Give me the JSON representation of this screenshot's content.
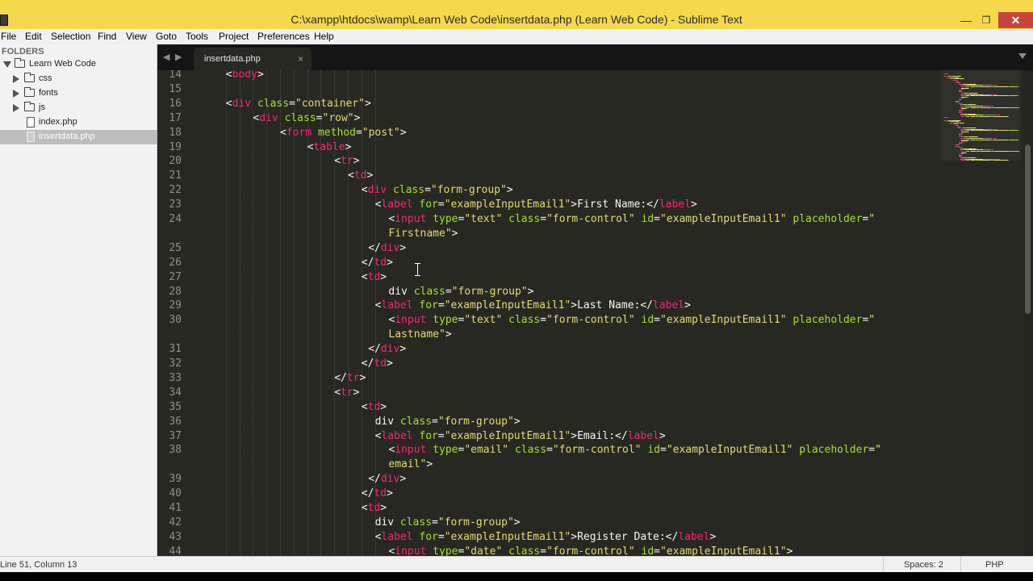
{
  "window": {
    "title": "C:\\xampp\\htdocs\\wamp\\Learn Web Code\\insertdata.php (Learn Web Code) - Sublime Text",
    "minimize": "—",
    "maximize": "❐",
    "close": "✕"
  },
  "menu": [
    "File",
    "Edit",
    "Selection",
    "Find",
    "View",
    "Goto",
    "Tools",
    "Project",
    "Preferences",
    "Help"
  ],
  "sidebar": {
    "header": "FOLDERS",
    "root": "Learn Web Code",
    "items": [
      {
        "label": "css",
        "type": "folder",
        "icon": "folder-icon"
      },
      {
        "label": "fonts",
        "type": "folder",
        "icon": "folder-icon"
      },
      {
        "label": "js",
        "type": "folder",
        "icon": "folder-icon"
      },
      {
        "label": "index.php",
        "type": "file",
        "icon": "file-icon"
      },
      {
        "label": "insertdata.php",
        "type": "file",
        "icon": "file-icon",
        "active": true
      }
    ]
  },
  "tabs": {
    "back": "◀",
    "forward": "▶",
    "active": {
      "label": "insertdata.php",
      "close": "×"
    }
  },
  "editor": {
    "lines": [
      {
        "n": "14",
        "indent": 2,
        "segs": [
          [
            "t",
            "<"
          ],
          [
            "k",
            "body"
          ],
          [
            "t",
            ">"
          ]
        ]
      },
      {
        "n": "15",
        "indent": 0,
        "segs": []
      },
      {
        "n": "16",
        "indent": 2,
        "segs": [
          [
            "t",
            "<"
          ],
          [
            "k",
            "div"
          ],
          [
            "t",
            " "
          ],
          [
            "a",
            "class"
          ],
          [
            "t",
            "="
          ],
          [
            "s",
            "\"container\""
          ],
          [
            "t",
            ">"
          ]
        ]
      },
      {
        "n": "17",
        "indent": 6,
        "segs": [
          [
            "t",
            "<"
          ],
          [
            "k",
            "div"
          ],
          [
            "t",
            " "
          ],
          [
            "a",
            "class"
          ],
          [
            "t",
            "="
          ],
          [
            "s",
            "\"row\""
          ],
          [
            "t",
            ">"
          ]
        ]
      },
      {
        "n": "18",
        "indent": 10,
        "segs": [
          [
            "t",
            "<"
          ],
          [
            "k",
            "form"
          ],
          [
            "t",
            " "
          ],
          [
            "a",
            "method"
          ],
          [
            "t",
            "="
          ],
          [
            "s",
            "\"post\""
          ],
          [
            "t",
            ">"
          ]
        ]
      },
      {
        "n": "19",
        "indent": 14,
        "segs": [
          [
            "t",
            "<"
          ],
          [
            "k",
            "table"
          ],
          [
            "t",
            ">"
          ]
        ]
      },
      {
        "n": "20",
        "indent": 18,
        "segs": [
          [
            "t",
            "<"
          ],
          [
            "k",
            "tr"
          ],
          [
            "t",
            ">"
          ]
        ]
      },
      {
        "n": "21",
        "indent": 20,
        "segs": [
          [
            "t",
            "<"
          ],
          [
            "k",
            "td"
          ],
          [
            "t",
            ">"
          ]
        ]
      },
      {
        "n": "22",
        "indent": 22,
        "segs": [
          [
            "t",
            "<"
          ],
          [
            "k",
            "div"
          ],
          [
            "t",
            " "
          ],
          [
            "a",
            "class"
          ],
          [
            "t",
            "="
          ],
          [
            "s",
            "\"form-group\""
          ],
          [
            "t",
            ">"
          ]
        ]
      },
      {
        "n": "23",
        "indent": 24,
        "segs": [
          [
            "t",
            "<"
          ],
          [
            "k",
            "label"
          ],
          [
            "t",
            " "
          ],
          [
            "a",
            "for"
          ],
          [
            "t",
            "="
          ],
          [
            "s",
            "\"exampleInputEmail1\""
          ],
          [
            "t",
            ">First Name:</"
          ],
          [
            "k",
            "label"
          ],
          [
            "t",
            ">"
          ]
        ]
      },
      {
        "n": "24",
        "indent": 26,
        "segs": [
          [
            "t",
            "<"
          ],
          [
            "k",
            "input"
          ],
          [
            "t",
            " "
          ],
          [
            "a",
            "type"
          ],
          [
            "t",
            "="
          ],
          [
            "s",
            "\"text\""
          ],
          [
            "t",
            " "
          ],
          [
            "a",
            "class"
          ],
          [
            "t",
            "="
          ],
          [
            "s",
            "\"form-control\""
          ],
          [
            "t",
            " "
          ],
          [
            "a",
            "id"
          ],
          [
            "t",
            "="
          ],
          [
            "s",
            "\"exampleInputEmail1\""
          ],
          [
            "t",
            " "
          ],
          [
            "a",
            "placeholder"
          ],
          [
            "t",
            "="
          ],
          [
            "s",
            "\""
          ]
        ]
      },
      {
        "n": "",
        "indent": 26,
        "segs": [
          [
            "s",
            "Firstname\""
          ],
          [
            "t",
            ">"
          ]
        ]
      },
      {
        "n": "25",
        "indent": 23,
        "segs": [
          [
            "t",
            "</"
          ],
          [
            "k",
            "div"
          ],
          [
            "t",
            ">"
          ]
        ]
      },
      {
        "n": "26",
        "indent": 22,
        "segs": [
          [
            "t",
            "</"
          ],
          [
            "k",
            "td"
          ],
          [
            "t",
            ">"
          ]
        ]
      },
      {
        "n": "27",
        "indent": 22,
        "segs": [
          [
            "t",
            "<"
          ],
          [
            "k",
            "td"
          ],
          [
            "t",
            ">"
          ]
        ]
      },
      {
        "n": "28",
        "indent": 26,
        "segs": [
          [
            "t",
            "div "
          ],
          [
            "a",
            "class"
          ],
          [
            "t",
            "="
          ],
          [
            "s",
            "\"form-group\""
          ],
          [
            "t",
            ">"
          ]
        ]
      },
      {
        "n": "29",
        "indent": 24,
        "segs": [
          [
            "t",
            "<"
          ],
          [
            "k",
            "label"
          ],
          [
            "t",
            " "
          ],
          [
            "a",
            "for"
          ],
          [
            "t",
            "="
          ],
          [
            "s",
            "\"exampleInputEmail1\""
          ],
          [
            "t",
            ">Last Name:</"
          ],
          [
            "k",
            "label"
          ],
          [
            "t",
            ">"
          ]
        ]
      },
      {
        "n": "30",
        "indent": 26,
        "segs": [
          [
            "t",
            "<"
          ],
          [
            "k",
            "input"
          ],
          [
            "t",
            " "
          ],
          [
            "a",
            "type"
          ],
          [
            "t",
            "="
          ],
          [
            "s",
            "\"text\""
          ],
          [
            "t",
            " "
          ],
          [
            "a",
            "class"
          ],
          [
            "t",
            "="
          ],
          [
            "s",
            "\"form-control\""
          ],
          [
            "t",
            " "
          ],
          [
            "a",
            "id"
          ],
          [
            "t",
            "="
          ],
          [
            "s",
            "\"exampleInputEmail1\""
          ],
          [
            "t",
            " "
          ],
          [
            "a",
            "placeholder"
          ],
          [
            "t",
            "="
          ],
          [
            "s",
            "\""
          ]
        ]
      },
      {
        "n": "",
        "indent": 26,
        "segs": [
          [
            "s",
            "Lastname\""
          ],
          [
            "t",
            ">"
          ]
        ]
      },
      {
        "n": "31",
        "indent": 23,
        "segs": [
          [
            "t",
            "</"
          ],
          [
            "k",
            "div"
          ],
          [
            "t",
            ">"
          ]
        ]
      },
      {
        "n": "32",
        "indent": 22,
        "segs": [
          [
            "t",
            "</"
          ],
          [
            "k",
            "td"
          ],
          [
            "t",
            ">"
          ]
        ]
      },
      {
        "n": "33",
        "indent": 18,
        "segs": [
          [
            "t",
            "</"
          ],
          [
            "k",
            "tr"
          ],
          [
            "t",
            ">"
          ]
        ]
      },
      {
        "n": "34",
        "indent": 18,
        "segs": [
          [
            "t",
            "<"
          ],
          [
            "k",
            "tr"
          ],
          [
            "t",
            ">"
          ]
        ]
      },
      {
        "n": "35",
        "indent": 22,
        "segs": [
          [
            "t",
            "<"
          ],
          [
            "k",
            "td"
          ],
          [
            "t",
            ">"
          ]
        ]
      },
      {
        "n": "36",
        "indent": 24,
        "segs": [
          [
            "t",
            "div "
          ],
          [
            "a",
            "class"
          ],
          [
            "t",
            "="
          ],
          [
            "s",
            "\"form-group\""
          ],
          [
            "t",
            ">"
          ]
        ]
      },
      {
        "n": "37",
        "indent": 24,
        "segs": [
          [
            "t",
            "<"
          ],
          [
            "k",
            "label"
          ],
          [
            "t",
            " "
          ],
          [
            "a",
            "for"
          ],
          [
            "t",
            "="
          ],
          [
            "s",
            "\"exampleInputEmail1\""
          ],
          [
            "t",
            ">Email:</"
          ],
          [
            "k",
            "label"
          ],
          [
            "t",
            ">"
          ]
        ]
      },
      {
        "n": "38",
        "indent": 26,
        "segs": [
          [
            "t",
            "<"
          ],
          [
            "k",
            "input"
          ],
          [
            "t",
            " "
          ],
          [
            "a",
            "type"
          ],
          [
            "t",
            "="
          ],
          [
            "s",
            "\"email\""
          ],
          [
            "t",
            " "
          ],
          [
            "a",
            "class"
          ],
          [
            "t",
            "="
          ],
          [
            "s",
            "\"form-control\""
          ],
          [
            "t",
            " "
          ],
          [
            "a",
            "id"
          ],
          [
            "t",
            "="
          ],
          [
            "s",
            "\"exampleInputEmail1\""
          ],
          [
            "t",
            " "
          ],
          [
            "a",
            "placeholder"
          ],
          [
            "t",
            "="
          ],
          [
            "s",
            "\""
          ]
        ]
      },
      {
        "n": "",
        "indent": 26,
        "segs": [
          [
            "s",
            "email\""
          ],
          [
            "t",
            ">"
          ]
        ]
      },
      {
        "n": "39",
        "indent": 23,
        "segs": [
          [
            "t",
            "</"
          ],
          [
            "k",
            "div"
          ],
          [
            "t",
            ">"
          ]
        ]
      },
      {
        "n": "40",
        "indent": 22,
        "segs": [
          [
            "t",
            "</"
          ],
          [
            "k",
            "td"
          ],
          [
            "t",
            ">"
          ]
        ]
      },
      {
        "n": "41",
        "indent": 22,
        "segs": [
          [
            "t",
            "<"
          ],
          [
            "k",
            "td"
          ],
          [
            "t",
            ">"
          ]
        ]
      },
      {
        "n": "42",
        "indent": 24,
        "segs": [
          [
            "t",
            "div "
          ],
          [
            "a",
            "class"
          ],
          [
            "t",
            "="
          ],
          [
            "s",
            "\"form-group\""
          ],
          [
            "t",
            ">"
          ]
        ]
      },
      {
        "n": "43",
        "indent": 24,
        "segs": [
          [
            "t",
            "<"
          ],
          [
            "k",
            "label"
          ],
          [
            "t",
            " "
          ],
          [
            "a",
            "for"
          ],
          [
            "t",
            "="
          ],
          [
            "s",
            "\"exampleInputEmail1\""
          ],
          [
            "t",
            ">Register Date:</"
          ],
          [
            "k",
            "label"
          ],
          [
            "t",
            ">"
          ]
        ]
      },
      {
        "n": "44",
        "indent": 26,
        "segs": [
          [
            "t",
            "<"
          ],
          [
            "k",
            "input"
          ],
          [
            "t",
            " "
          ],
          [
            "a",
            "type"
          ],
          [
            "t",
            "="
          ],
          [
            "s",
            "\"date\""
          ],
          [
            "t",
            " "
          ],
          [
            "a",
            "class"
          ],
          [
            "t",
            "="
          ],
          [
            "s",
            "\"form-control\""
          ],
          [
            "t",
            " "
          ],
          [
            "a",
            "id"
          ],
          [
            "t",
            "="
          ],
          [
            "s",
            "\"exampleInputEmail1\""
          ],
          [
            "t",
            ">"
          ]
        ]
      }
    ]
  },
  "status": {
    "position": "Line 51, Column 13",
    "indentation": "Spaces: 2",
    "syntax": "PHP"
  },
  "colors": {
    "tag": "#f92672",
    "attribute": "#a6e22e",
    "string": "#e6db74",
    "text": "#f8f8f2",
    "editor_bg": "#272822",
    "titlebar": "#f5d84c"
  }
}
